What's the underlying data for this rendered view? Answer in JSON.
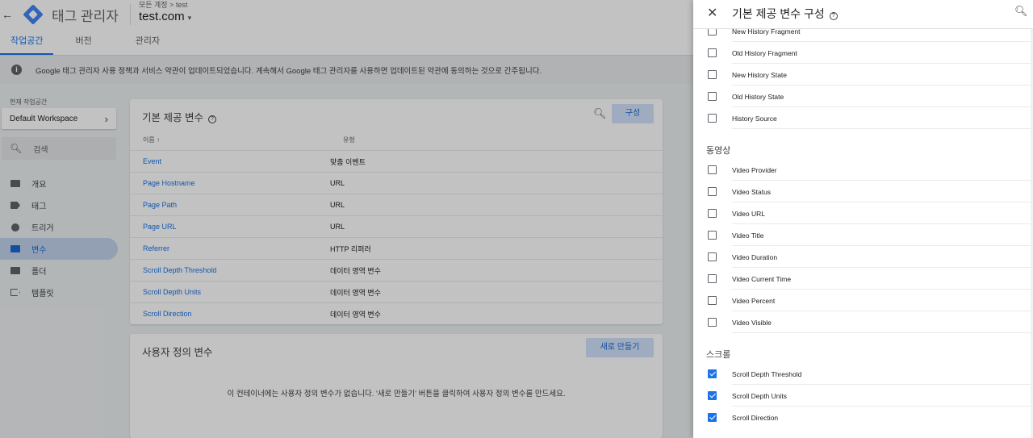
{
  "header": {
    "back_icon": "arrow-back-icon",
    "app_name": "태그 관리자",
    "breadcrumb": "모든 계정 > test",
    "container_name": "test.com",
    "caret": "▾"
  },
  "tabs": [
    {
      "label": "작업공간",
      "active": true
    },
    {
      "label": "버전",
      "active": false
    },
    {
      "label": "관리자",
      "active": false
    }
  ],
  "notice": {
    "icon": "info-icon",
    "text": "Google 태그 관리자 사용 정책과 서비스 약관이 업데이트되었습니다. 계속해서 Google 태그 관리자를 사용하면 업데이트된 약관에 동의하는 것으로 간주됩니다."
  },
  "sidebar": {
    "workspace_label": "현재 작업공간",
    "workspace_name": "Default Workspace",
    "search_placeholder": "검색",
    "items": [
      {
        "label": "개요",
        "icon": "overview-icon",
        "active": false
      },
      {
        "label": "태그",
        "icon": "tag-icon",
        "active": false
      },
      {
        "label": "트리거",
        "icon": "trigger-icon",
        "active": false
      },
      {
        "label": "변수",
        "icon": "variable-icon",
        "active": true
      },
      {
        "label": "폴더",
        "icon": "folder-icon",
        "active": false
      },
      {
        "label": "템플릿",
        "icon": "template-icon",
        "active": false
      }
    ]
  },
  "builtin_card": {
    "title": "기본 제공 변수",
    "configure_label": "구성",
    "col_name": "이름 ↑",
    "col_type": "유형",
    "rows": [
      {
        "name": "Event",
        "type": "맞춤 이벤트"
      },
      {
        "name": "Page Hostname",
        "type": "URL"
      },
      {
        "name": "Page Path",
        "type": "URL"
      },
      {
        "name": "Page URL",
        "type": "URL"
      },
      {
        "name": "Referrer",
        "type": "HTTP 리퍼러"
      },
      {
        "name": "Scroll Depth Threshold",
        "type": "데이터 영역 변수"
      },
      {
        "name": "Scroll Depth Units",
        "type": "데이터 영역 변수"
      },
      {
        "name": "Scroll Direction",
        "type": "데이터 영역 변수"
      }
    ]
  },
  "user_card": {
    "title": "사용자 정의 변수",
    "new_label": "새로 만들기",
    "empty_text": "이 컨테이너에는 사용자 정의 변수가 없습니다. '새로 만들기' 버튼을 클릭하여 사용자 정의 변수를 만드세요."
  },
  "panel": {
    "title": "기본 제공 변수 구성",
    "history_items": [
      {
        "label": "New History Fragment",
        "checked": false
      },
      {
        "label": "Old History Fragment",
        "checked": false
      },
      {
        "label": "New History State",
        "checked": false
      },
      {
        "label": "Old History State",
        "checked": false
      },
      {
        "label": "History Source",
        "checked": false
      }
    ],
    "video_section": "동영상",
    "video_items": [
      {
        "label": "Video Provider",
        "checked": false
      },
      {
        "label": "Video Status",
        "checked": false
      },
      {
        "label": "Video URL",
        "checked": false
      },
      {
        "label": "Video Title",
        "checked": false
      },
      {
        "label": "Video Duration",
        "checked": false
      },
      {
        "label": "Video Current Time",
        "checked": false
      },
      {
        "label": "Video Percent",
        "checked": false
      },
      {
        "label": "Video Visible",
        "checked": false
      }
    ],
    "scroll_section": "스크롤",
    "scroll_items": [
      {
        "label": "Scroll Depth Threshold",
        "checked": true
      },
      {
        "label": "Scroll Depth Units",
        "checked": true
      },
      {
        "label": "Scroll Direction",
        "checked": true
      }
    ]
  },
  "colors": {
    "accent": "#1a73e8",
    "active_nav_bg": "#c2d3ec",
    "button_bg": "#d2e3fc"
  }
}
